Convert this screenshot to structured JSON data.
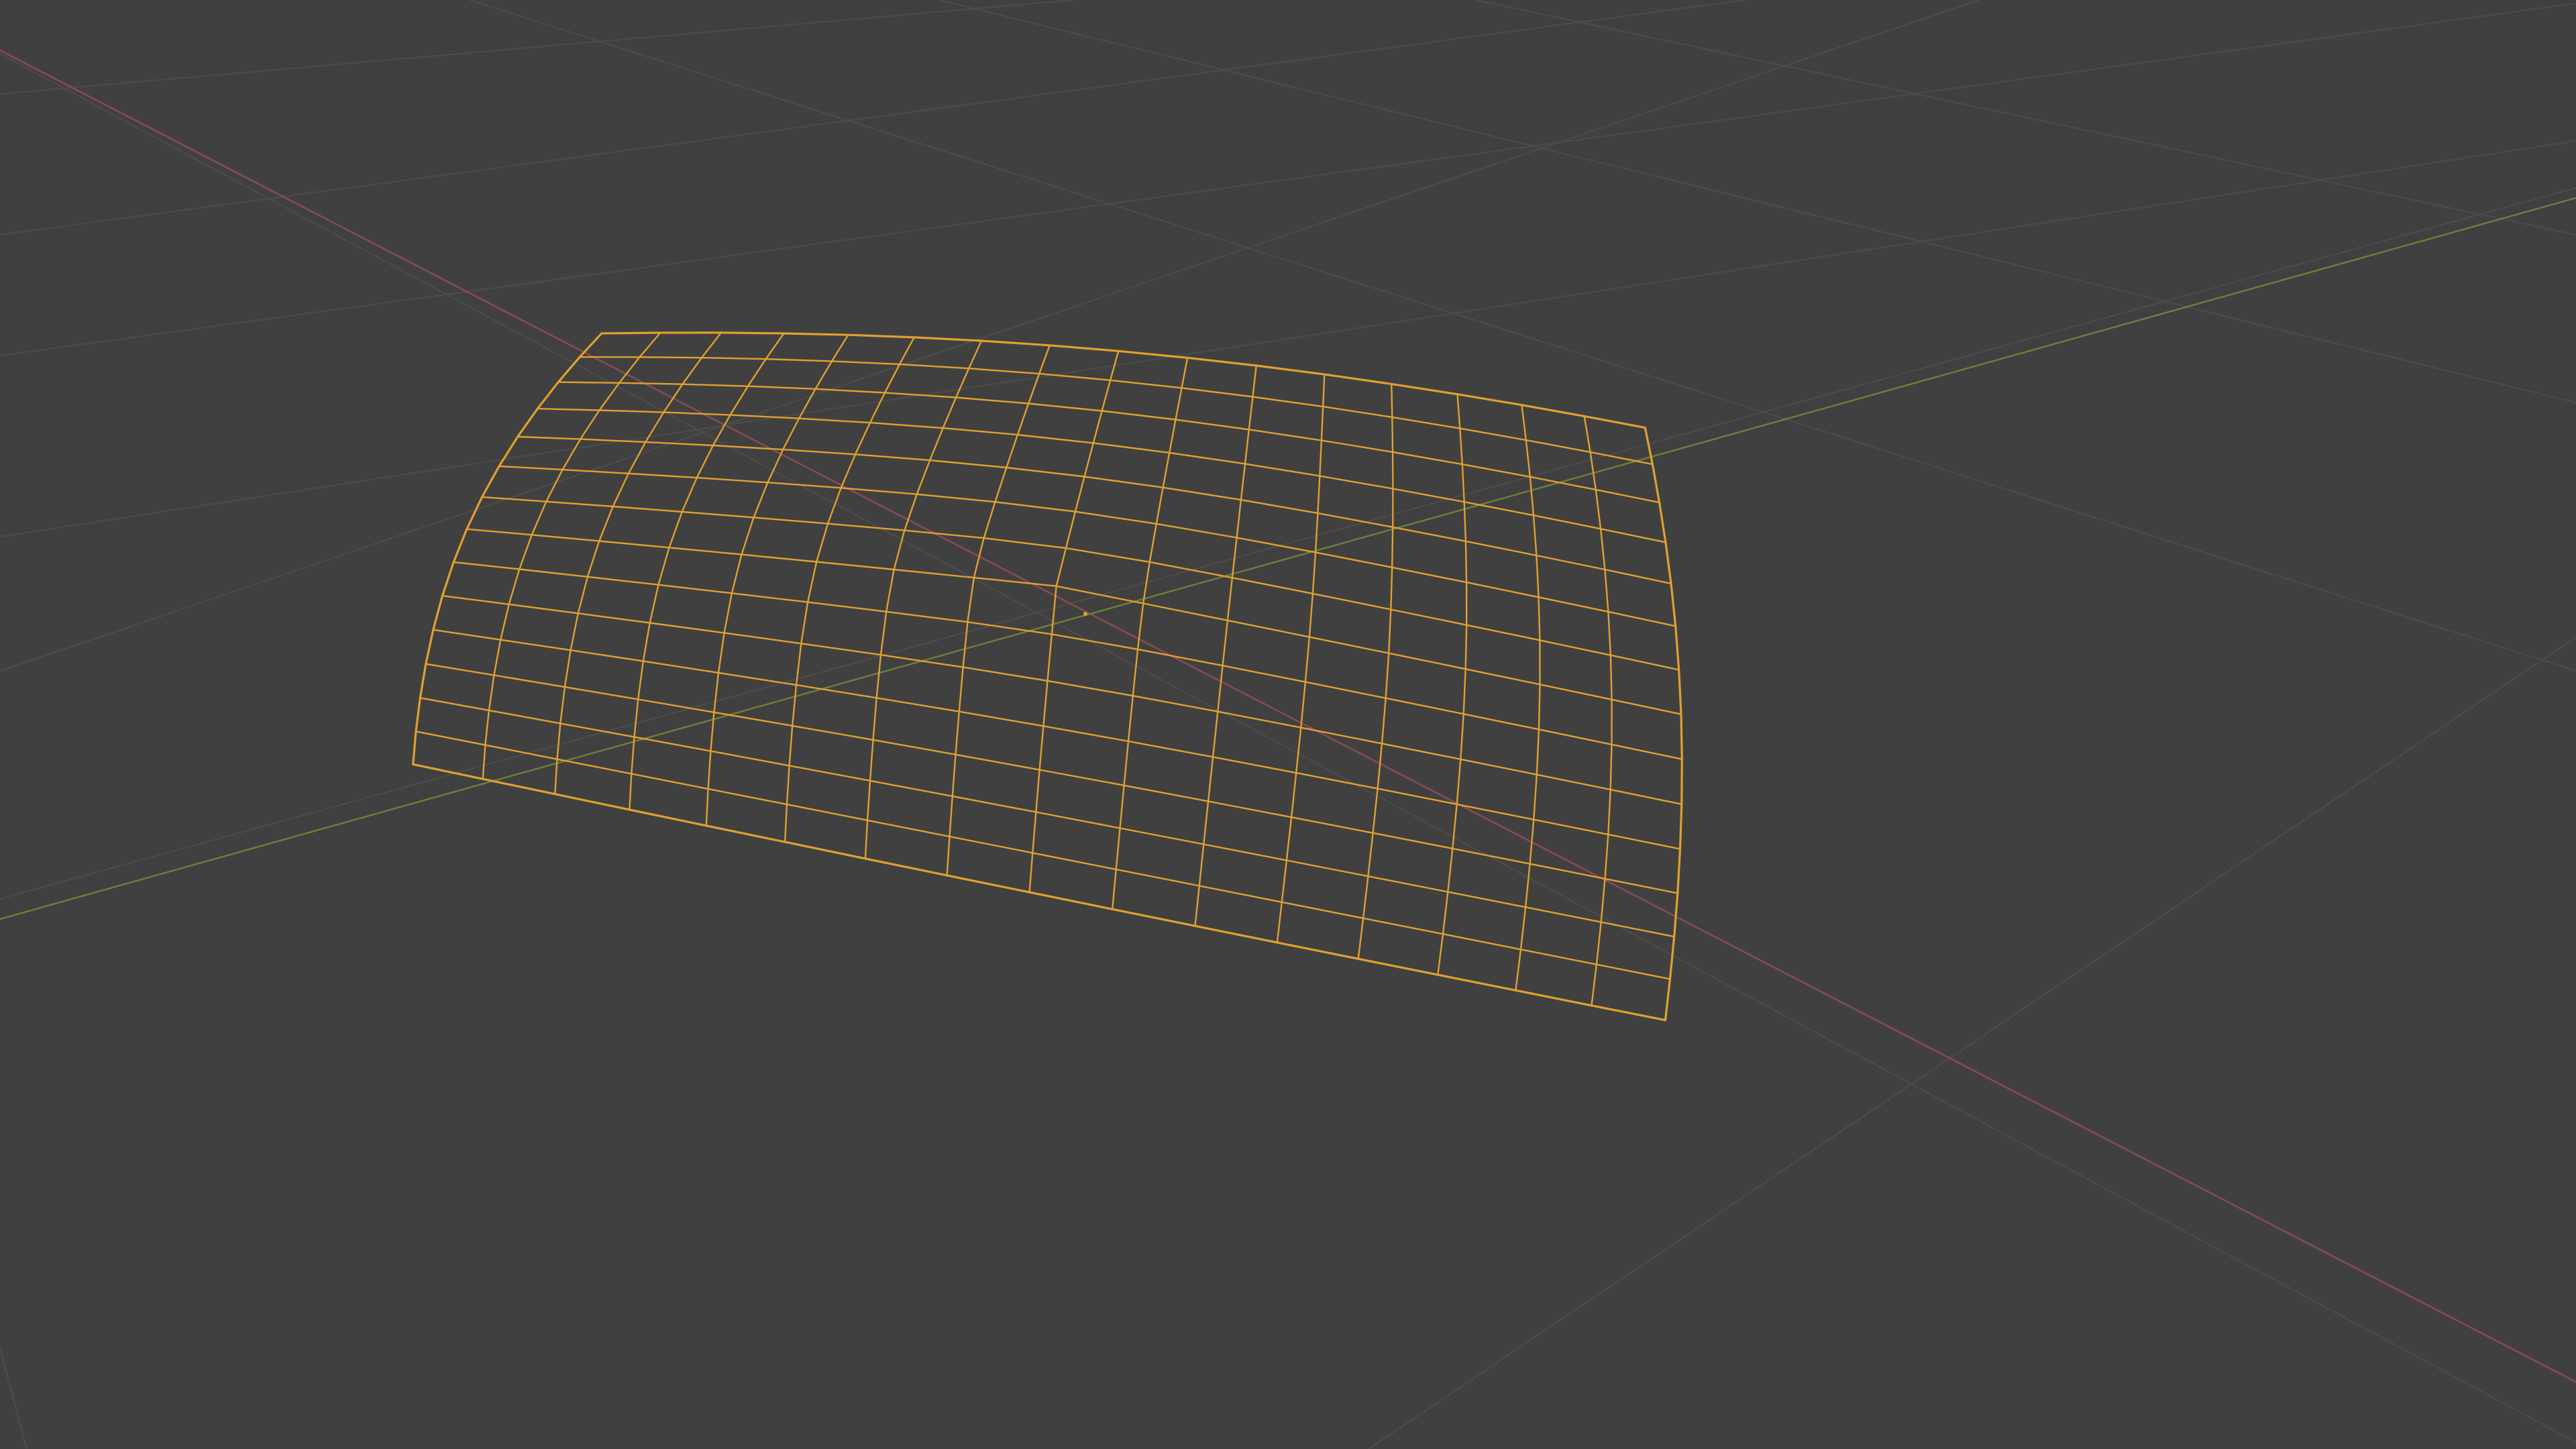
{
  "viewport": {
    "mode": "wireframe",
    "background_color": "#404040",
    "grid_color": "#4d4d4d",
    "x_axis_color": "#8a4b54",
    "y_axis_color": "#6b7f3a",
    "wire_color": "#e0a030",
    "object": "selected-mesh",
    "origin_marker": "object-origin-dot"
  }
}
